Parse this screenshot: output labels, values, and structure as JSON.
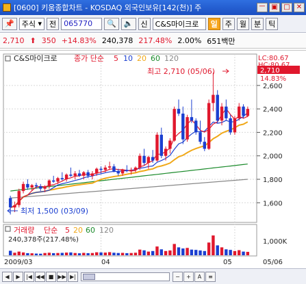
{
  "window": {
    "title": "[0600] 키움종합차트 - KOSDAQ 외국인보유[142(천)] 주",
    "buttons": [
      "ㅡ",
      "▣",
      "□",
      "✕"
    ]
  },
  "toolbar": {
    "market": "주식",
    "period_label": "전",
    "code": "065770",
    "stock_prefix": "신",
    "stock_name": "C&S마이크로",
    "tabs": [
      "일",
      "주",
      "월",
      "분",
      "틱"
    ],
    "active_tab": "일"
  },
  "info": {
    "price": "2,710",
    "change": "350",
    "change_pct": "+14.83%",
    "volume": "240,378",
    "volume_pct": "217.48%",
    "ratio": "2.00%",
    "amount": "651백만"
  },
  "chart": {
    "stock_label": "C&S마이크로",
    "ma_label": "종가 단순",
    "ma_periods": [
      "5",
      "10",
      "20",
      "60",
      "120"
    ],
    "lc_label": "LC:80.67",
    "hc_label": "HC:80.67",
    "price_tag": "2,710",
    "pct_tag": "14.83%",
    "high_note": "최고 2,710 (05/06)",
    "low_note": "최저 1,500 (03/09)",
    "y_ticks": [
      "2,600",
      "2,400",
      "2,200",
      "2,000",
      "1,800",
      "1,600"
    ],
    "volume_label": "거래량",
    "volume_ma_label": "단순",
    "volume_ma_periods": [
      "5",
      "20",
      "60",
      "120"
    ],
    "volume_info": "240,378주(217.48%)",
    "volume_tick": "1,000K",
    "x_labels": [
      "2009/03",
      "04",
      "05",
      "05/06"
    ]
  },
  "colors": {
    "up": "#e0182d",
    "down": "#1b3fd0",
    "ma5": "#e0182d",
    "ma10": "#1b3fd0",
    "ma20": "#f0a818",
    "ma60": "#1a8a2a",
    "ma120": "#888888"
  },
  "chart_data": {
    "type": "candlestick",
    "period": "2009/03 – 2009/05/06",
    "ohlc": [
      [
        1640,
        1660,
        1500,
        1560
      ],
      [
        1560,
        1610,
        1520,
        1580
      ],
      [
        1580,
        1720,
        1560,
        1700
      ],
      [
        1700,
        1780,
        1680,
        1760
      ],
      [
        1760,
        1800,
        1710,
        1730
      ],
      [
        1730,
        1760,
        1700,
        1750
      ],
      [
        1750,
        1770,
        1720,
        1740
      ],
      [
        1740,
        1760,
        1700,
        1720
      ],
      [
        1720,
        1750,
        1690,
        1740
      ],
      [
        1740,
        1800,
        1720,
        1790
      ],
      [
        1790,
        1830,
        1770,
        1780
      ],
      [
        1780,
        1820,
        1760,
        1810
      ],
      [
        1810,
        1860,
        1790,
        1800
      ],
      [
        1800,
        1850,
        1780,
        1840
      ],
      [
        1840,
        1900,
        1820,
        1830
      ],
      [
        1830,
        1870,
        1800,
        1850
      ],
      [
        1850,
        1880,
        1820,
        1830
      ],
      [
        1830,
        1870,
        1800,
        1860
      ],
      [
        1860,
        1880,
        1810,
        1830
      ],
      [
        1830,
        1870,
        1800,
        1850
      ],
      [
        1850,
        1900,
        1830,
        1890
      ],
      [
        1890,
        1910,
        1850,
        1880
      ],
      [
        1880,
        1920,
        1860,
        1900
      ],
      [
        1900,
        1950,
        1880,
        1910
      ],
      [
        1910,
        1930,
        1860,
        1870
      ],
      [
        1870,
        1890,
        1830,
        1850
      ],
      [
        1850,
        1890,
        1830,
        1880
      ],
      [
        1880,
        1920,
        1860,
        1870
      ],
      [
        1870,
        1900,
        1840,
        1880
      ],
      [
        1880,
        1910,
        1860,
        1900
      ],
      [
        1900,
        2020,
        1880,
        2000
      ],
      [
        2000,
        2060,
        1920,
        1940
      ],
      [
        1940,
        2000,
        1890,
        1990
      ],
      [
        1990,
        2050,
        1940,
        1960
      ],
      [
        1960,
        2200,
        1950,
        2180
      ],
      [
        2180,
        2240,
        1980,
        2000
      ],
      [
        2000,
        2080,
        1960,
        2060
      ],
      [
        2060,
        2150,
        2020,
        2130
      ],
      [
        2130,
        2420,
        2120,
        2400
      ],
      [
        2400,
        2480,
        2340,
        2360
      ],
      [
        2360,
        2420,
        2100,
        2140
      ],
      [
        2140,
        2350,
        2120,
        2330
      ],
      [
        2330,
        2480,
        2280,
        2300
      ],
      [
        2300,
        2320,
        2180,
        2200
      ],
      [
        2200,
        2300,
        2100,
        2120
      ],
      [
        2120,
        2160,
        2040,
        2060
      ],
      [
        2060,
        2480,
        2050,
        2450
      ],
      [
        2450,
        2710,
        2380,
        2520
      ],
      [
        2520,
        2560,
        2280,
        2300
      ],
      [
        2300,
        2450,
        2260,
        2420
      ],
      [
        2420,
        2480,
        2300,
        2320
      ],
      [
        2320,
        2350,
        2180,
        2200
      ],
      [
        2200,
        2340,
        2180,
        2320
      ],
      [
        2320,
        2450,
        2300,
        2420
      ],
      [
        2420,
        2440,
        2320,
        2340
      ],
      [
        2340,
        2420,
        2330,
        2400
      ]
    ],
    "volume_k": [
      320,
      180,
      260,
      200,
      150,
      140,
      120,
      110,
      160,
      180,
      150,
      160,
      170,
      190,
      200,
      160,
      140,
      170,
      150,
      160,
      210,
      200,
      190,
      220,
      180,
      160,
      170,
      150,
      160,
      180,
      400,
      350,
      260,
      300,
      620,
      420,
      300,
      340,
      800,
      560,
      480,
      520,
      400,
      380,
      340,
      300,
      900,
      1400,
      700,
      560,
      420,
      380,
      300,
      360,
      260,
      240
    ],
    "ylim": [
      1450,
      2780
    ],
    "volume_ylim": [
      0,
      1500
    ]
  }
}
